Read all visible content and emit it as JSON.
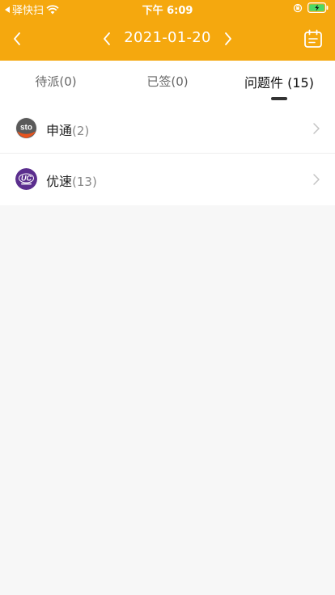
{
  "status_bar": {
    "back_app": "驿快扫",
    "time": "下午 6:09"
  },
  "nav": {
    "date": "2021-01-20"
  },
  "tabs": [
    {
      "label": "待派",
      "count": "(0)"
    },
    {
      "label": "已签",
      "count": "(0)"
    },
    {
      "label": "问题件",
      "count": "(15)"
    }
  ],
  "active_tab": 2,
  "carriers": [
    {
      "name": "申通",
      "count": "(2)",
      "logo_text": "sto",
      "logo_color": "#5a5a5a",
      "logo_accent": "#e8541f"
    },
    {
      "name": "优速",
      "count": "(13)",
      "logo_text": "UC",
      "logo_color": "#5b2e8e"
    }
  ],
  "colors": {
    "header": "#f5a80e",
    "background": "#f7f7f7"
  }
}
